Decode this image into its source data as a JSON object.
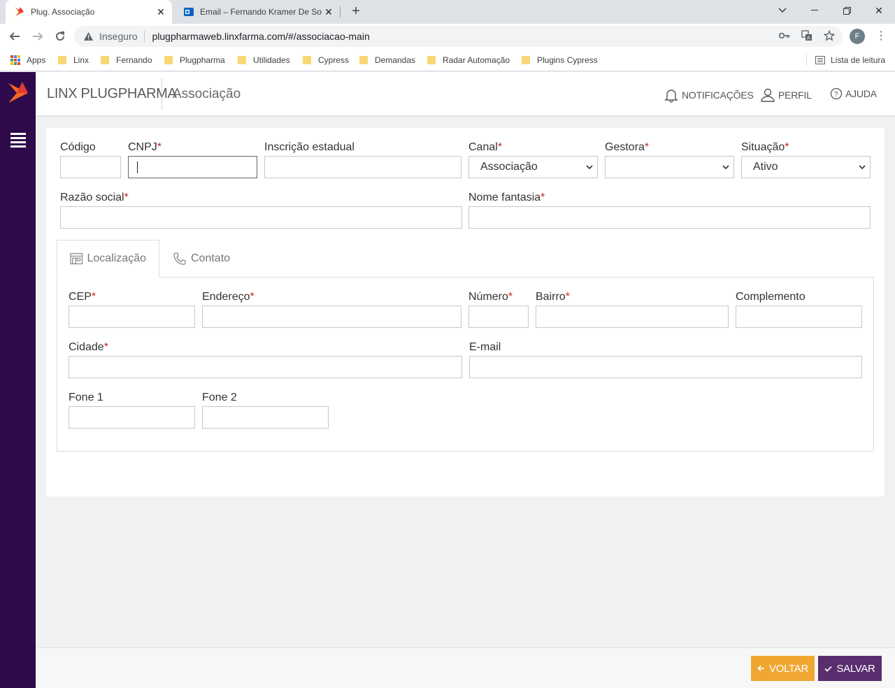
{
  "browser": {
    "tabs": [
      {
        "title": "Plug. Associação",
        "active": true
      },
      {
        "title": "Email – Fernando Kramer De Sou",
        "active": false
      }
    ],
    "security_label": "Inseguro",
    "url": "plugpharmaweb.linxfarma.com/#/associacao-main",
    "profile_initial": "F",
    "bookmarks": [
      "Apps",
      "Linx",
      "Fernando",
      "Plugpharma",
      "Utilidades",
      "Cypress",
      "Demandas",
      "Radar Automação",
      "Plugins Cypress"
    ],
    "reading_list": "Lista de leitura"
  },
  "header": {
    "brand": "LINX PLUGPHARMA",
    "page_title": "Associação",
    "links": {
      "notifications": "NOTIFICAÇÕES",
      "profile": "PERFIL",
      "help": "AJUDA"
    }
  },
  "form": {
    "codigo_label": "Código",
    "cnpj_label": "CNPJ",
    "inscricao_label": "Inscrição estadual",
    "canal_label": "Canal",
    "canal_value": "Associação",
    "gestora_label": "Gestora",
    "gestora_value": "",
    "situacao_label": "Situação",
    "situacao_value": "Ativo",
    "razao_label": "Razão social",
    "fantasia_label": "Nome fantasia",
    "required_mark": "*"
  },
  "tabs": {
    "localizacao": "Localização",
    "contato": "Contato"
  },
  "location": {
    "cep_label": "CEP",
    "endereco_label": "Endereço",
    "numero_label": "Número",
    "bairro_label": "Bairro",
    "complemento_label": "Complemento",
    "cidade_label": "Cidade",
    "email_label": "E-mail",
    "fone1_label": "Fone 1",
    "fone2_label": "Fone 2"
  },
  "footer": {
    "back_label": "VOLTAR",
    "save_label": "SALVAR"
  },
  "colors": {
    "sidebar": "#2e0a4a",
    "back_button": "#f0a732",
    "save_button": "#5a2d6e",
    "required": "#c62828"
  }
}
